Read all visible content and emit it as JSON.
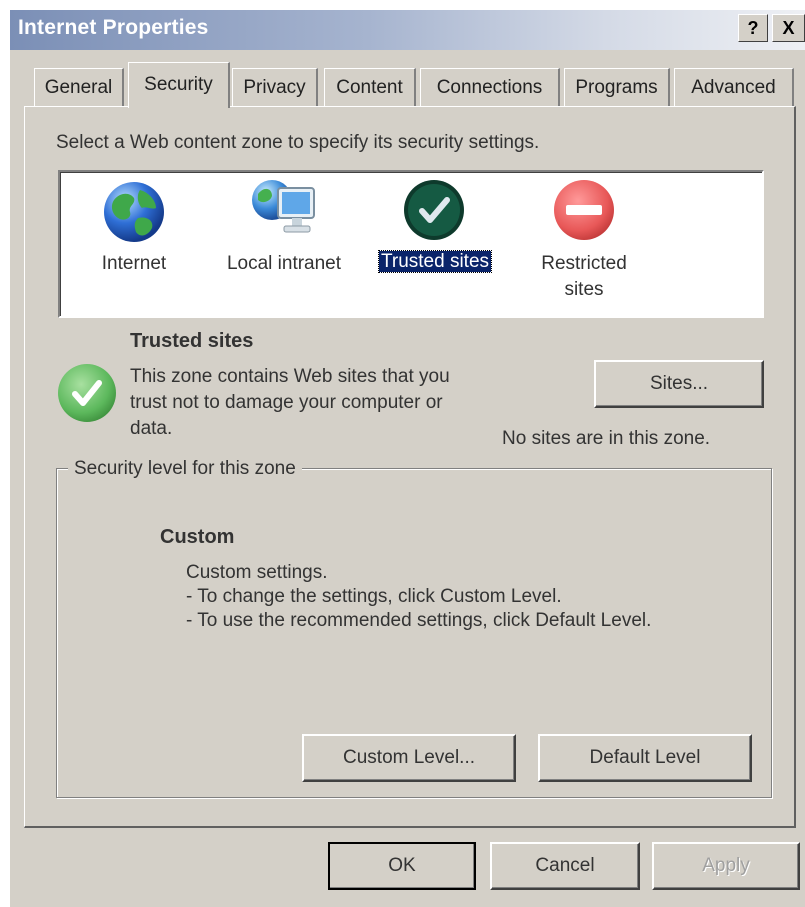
{
  "window": {
    "title": "Internet Properties",
    "help_label": "?",
    "close_label": "X"
  },
  "tabs": [
    {
      "label": "General"
    },
    {
      "label": "Security",
      "active": true
    },
    {
      "label": "Privacy"
    },
    {
      "label": "Content"
    },
    {
      "label": "Connections"
    },
    {
      "label": "Programs"
    },
    {
      "label": "Advanced"
    }
  ],
  "security": {
    "instruction": "Select a Web content zone to specify its security settings.",
    "zones": [
      {
        "label": "Internet",
        "icon": "globe-icon"
      },
      {
        "label": "Local intranet",
        "icon": "intranet-icon"
      },
      {
        "label": "Trusted sites",
        "icon": "trusted-check-icon",
        "selected": true
      },
      {
        "label_line1": "Restricted",
        "label_line2": "sites",
        "icon": "restricted-icon"
      }
    ],
    "selected_zone": {
      "title": "Trusted sites",
      "desc_line1": "This zone contains Web sites that you",
      "desc_line2": "trust not to damage your computer or",
      "desc_line3": "data.",
      "sites_button": "Sites...",
      "sites_status": "No sites are in this zone."
    },
    "level_group": {
      "legend": "Security level for this zone",
      "level_name": "Custom",
      "line1": "Custom settings.",
      "line2": "- To change the settings, click Custom Level.",
      "line3": "- To use the recommended settings, click Default Level.",
      "custom_level_button": "Custom Level...",
      "default_level_button": "Default Level"
    }
  },
  "footer": {
    "ok_label": "OK",
    "cancel_label": "Cancel",
    "apply_label": "Apply",
    "apply_enabled": false
  },
  "colors": {
    "dialog_bg": "#d4d0c8",
    "selection_bg": "#0a246a",
    "trusted_green": "#4caf50",
    "restricted_red": "#e85858"
  }
}
